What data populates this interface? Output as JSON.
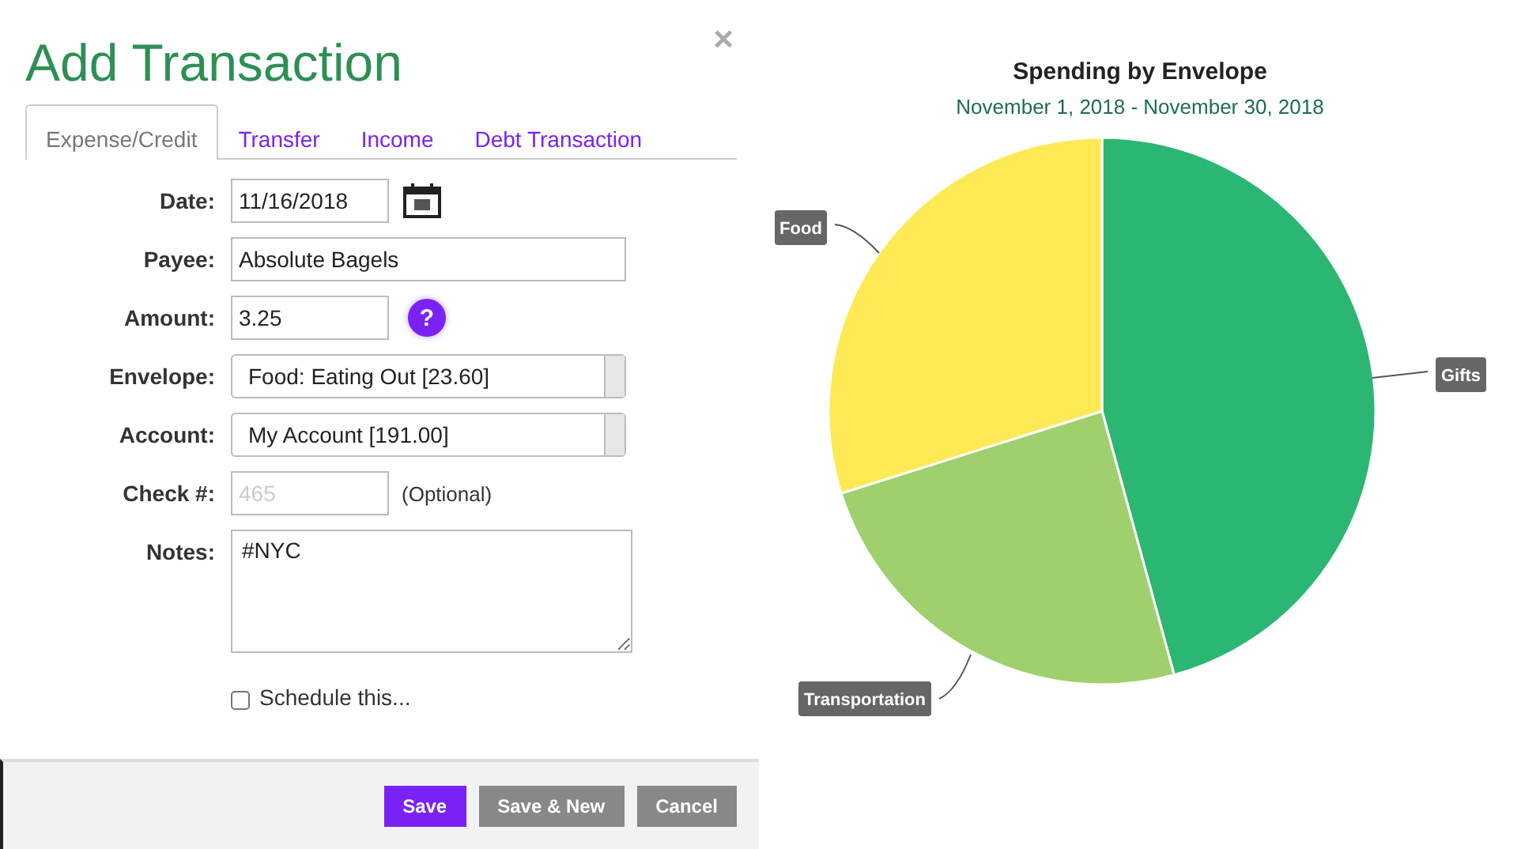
{
  "dialog": {
    "title": "Add Transaction",
    "close": "×",
    "tabs": [
      {
        "label": "Expense/Credit",
        "selected": true
      },
      {
        "label": "Transfer",
        "selected": false
      },
      {
        "label": "Income",
        "selected": false
      },
      {
        "label": "Debt Transaction",
        "selected": false
      }
    ],
    "fields": [
      {
        "kind": "date",
        "label": "Date:",
        "value": "11/16/2018"
      },
      {
        "kind": "text",
        "label": "Payee:",
        "value": "Absolute Bagels"
      },
      {
        "kind": "amount",
        "label": "Amount:",
        "value": "3.25",
        "help": "?"
      },
      {
        "kind": "select",
        "label": "Envelope:",
        "value": "Food: Eating Out [23.60]"
      },
      {
        "kind": "select",
        "label": "Account:",
        "value": "My Account [191.00]"
      },
      {
        "kind": "check",
        "label": "Check #:",
        "placeholder": "465",
        "hint": "(Optional)"
      },
      {
        "kind": "notes",
        "label": "Notes:",
        "value": "#NYC"
      }
    ],
    "schedule": {
      "label": "Schedule this...",
      "checked": false
    },
    "buttons": [
      {
        "label": "Save",
        "kind": "primary"
      },
      {
        "label": "Save & New",
        "kind": "secondary"
      },
      {
        "label": "Cancel",
        "kind": "secondary"
      }
    ]
  },
  "chart": {
    "title": "Spending by Envelope",
    "subtitle": "November 1, 2018 - November 30, 2018",
    "slices": [
      {
        "label": "Gifts",
        "color": "#2bb673"
      },
      {
        "label": "Transportation",
        "color": "#a0cf6e"
      },
      {
        "label": "Food",
        "color": "#ffe954"
      }
    ]
  }
}
